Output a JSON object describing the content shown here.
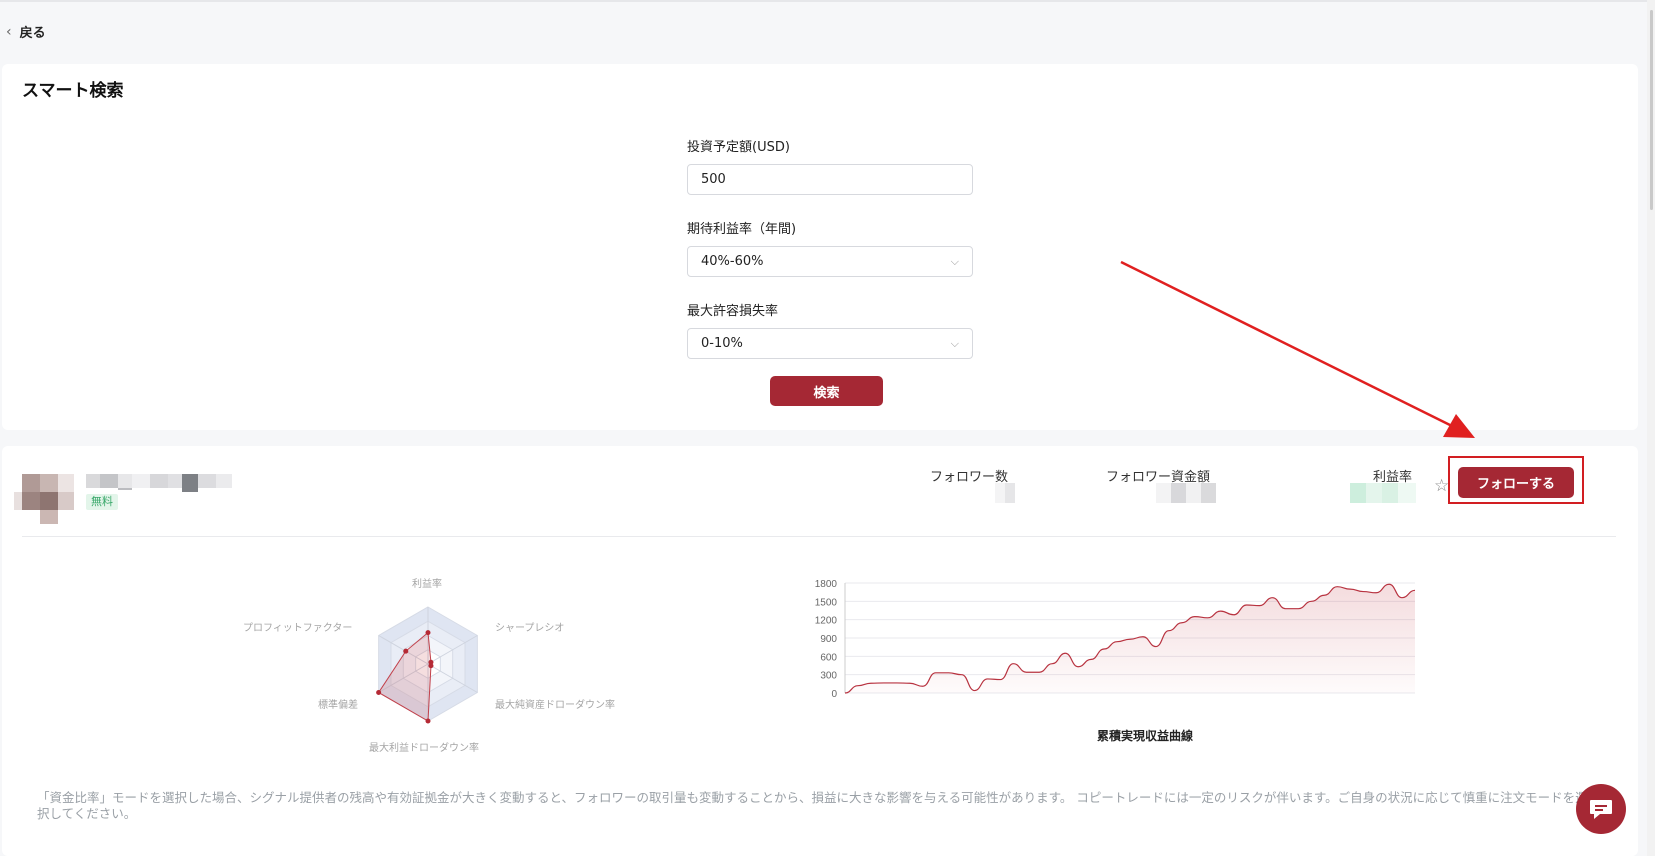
{
  "nav": {
    "back_label": "戻る"
  },
  "search_card": {
    "title": "スマート検索",
    "fields": [
      {
        "label": "投資予定額(USD)",
        "value": "500"
      },
      {
        "label": "期待利益率（年間)",
        "value": "40%-60%"
      },
      {
        "label": "最大許容損失率",
        "value": "0-10%"
      }
    ],
    "search_button": "検索"
  },
  "result": {
    "badge": "無料",
    "stats": [
      {
        "label": "フォロワー数"
      },
      {
        "label": "フォロワー資金額"
      },
      {
        "label": "利益率"
      }
    ],
    "follow_button": "フォローする",
    "icons": {
      "favorite": "star-outline-icon",
      "chat": "chat-bubble-icon"
    }
  },
  "radar": {
    "axes": [
      "利益率",
      "シャープレシオ",
      "最大純資産ドローダウン率",
      "最大利益ドローダウン率",
      "標準偏差",
      "プロフィットファクター"
    ],
    "values": [
      0.55,
      0.0,
      0.0,
      1.0,
      1.0,
      0.45
    ]
  },
  "chart_data": {
    "type": "area",
    "title": "累積実現収益曲線",
    "xlabel": "",
    "ylabel": "",
    "ylim": [
      0,
      1800
    ],
    "yticks": [
      0,
      300,
      600,
      900,
      1200,
      1500,
      1800
    ],
    "grid": true,
    "series": [
      {
        "values": [
          0,
          120,
          160,
          165,
          165,
          160,
          110,
          330,
          330,
          300,
          40,
          230,
          220,
          480,
          340,
          340,
          480,
          650,
          430,
          550,
          720,
          840,
          880,
          920,
          760,
          1020,
          1150,
          1250,
          1230,
          1340,
          1280,
          1440,
          1430,
          1560,
          1380,
          1380,
          1500,
          1600,
          1740,
          1700,
          1660,
          1640,
          1780,
          1560,
          1680
        ]
      }
    ]
  },
  "disclaimer": "「資金比率」モードを選択した場合、シグナル提供者の残高や有効証拠金が大きく変動すると、フォロワーの取引量も変動することから、損益に大きな影響を与える可能性があります。 コピートレードには一定のリスクが伴います。ご自身の状況に応じて慎重に注文モードを選択してください。",
  "colors": {
    "primary": "#a52834",
    "annotation": "#d21e22",
    "badge_green": "#3aa86b"
  }
}
